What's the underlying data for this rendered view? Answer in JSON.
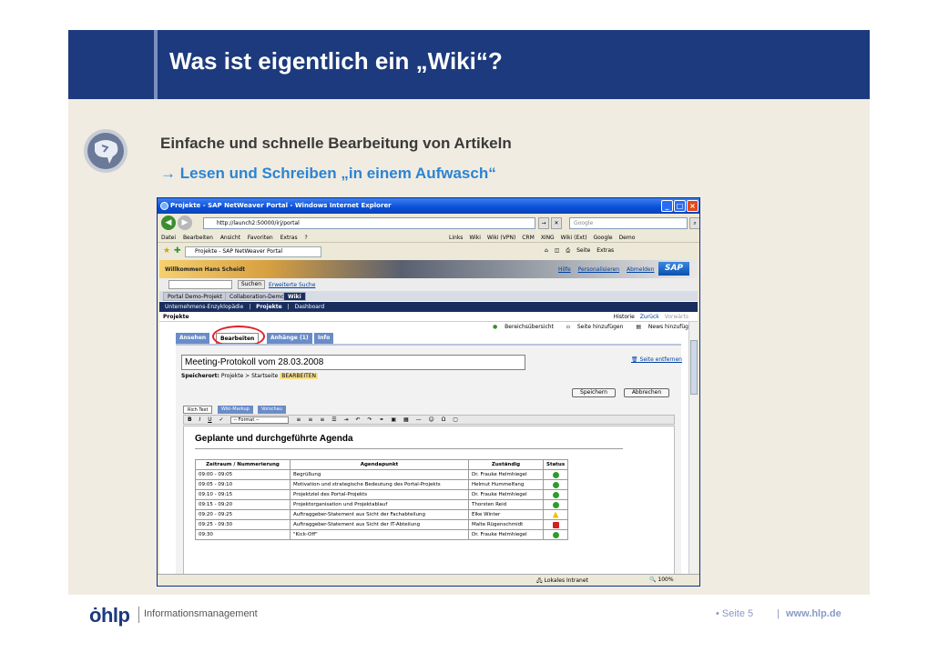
{
  "slide": {
    "title": "Was ist eigentlich ein „Wiki“?",
    "bullet1": "Einfache und schnelle Bearbeitung von Artikeln",
    "bullet2": "→ Lesen und Schreiben „in einem Aufwasch“"
  },
  "browser": {
    "window_title": "Projekte - SAP NetWeaver Portal - Windows Internet Explorer",
    "address": "http://launch2:50000/irj/portal",
    "search_placeholder": "Google",
    "menu": [
      "Datei",
      "Bearbeiten",
      "Ansicht",
      "Favoriten",
      "Extras",
      "?"
    ],
    "links_label": "Links",
    "links": [
      "Wiki",
      "Wiki (VPN)",
      "CRM",
      "XING",
      "Wiki (Ext)",
      "Google",
      "Demo"
    ],
    "tab_title": "Projekte - SAP NetWeaver Portal",
    "page_label": "Seite",
    "extras_label": "Extras",
    "status_zone": "Lokales Intranet",
    "zoom": "100%"
  },
  "portal": {
    "welcome": "Willkommen Hans Scheidt",
    "top_links": [
      "Hilfe",
      "Personalisieren",
      "Abmelden"
    ],
    "sap_logo": "SAP",
    "search_button": "Suchen",
    "search_link": "Erweiterte Suche",
    "nav": [
      "Portal Demo-Projekt",
      "Collaboration-Demo",
      "Wiki"
    ],
    "subnav": [
      "Unternehmens-Enzyklopädie",
      "|",
      "Projekte",
      "|",
      "Dashboard"
    ],
    "section": "Projekte",
    "history": [
      "Historie",
      "Zurück",
      "Vorwärts"
    ],
    "actions": [
      "Bereichsübersicht",
      "Seite hinzufügen",
      "News hinzufügen"
    ],
    "wiki_tabs": [
      "Ansehen",
      "Bearbeiten",
      "Anhänge (1)",
      "Info"
    ],
    "page_title_value": "Meeting-Protokoll vom 28.03.2008",
    "remove_page": "Seite entfernen",
    "save_label": "Speicherort:",
    "save_path": "Projekte > Startseite",
    "save_badge": "BEARBEITEN",
    "save_button": "Speichern",
    "cancel_button": "Abbrechen",
    "mode_tabs": [
      "Rich Text",
      "Wiki-Markup",
      "Vorschau"
    ],
    "format_select": "-- Format --"
  },
  "agenda": {
    "heading": "Geplante und durchgeführte Agenda",
    "headers": [
      "Zeitraum / Nummerierung",
      "Agendapunkt",
      "Zuständig",
      "Status"
    ],
    "rows": [
      [
        "09:00 - 09:05",
        "Begrüßung",
        "Dr. Frauke Helmhiegel",
        "ok"
      ],
      [
        "09:05 - 09:10",
        "Motivation und strategische Bedeutung des Portal-Projekts",
        "Helmut Hummelfang",
        "ok"
      ],
      [
        "09:10 - 09:15",
        "Projektziel des Portal-Projekts",
        "Dr. Frauke Helmhiegel",
        "ok"
      ],
      [
        "09:15 - 09:20",
        "Projektorganisation und Projektablauf",
        "Thorsten Reid",
        "ok"
      ],
      [
        "09:20 - 09:25",
        "Auftraggeber-Statement aus Sicht der Fachabteilung",
        "Elke Winter",
        "warn"
      ],
      [
        "09:25 - 09:30",
        "Auftraggeber-Statement aus Sicht der IT-Abteilung",
        "Malte Rügenschmidt",
        "err"
      ],
      [
        "09:30",
        "\"Kick-Off\"",
        "Dr. Frauke Helmhiegel",
        "ok"
      ]
    ]
  },
  "footer": {
    "logo": "hlp",
    "subtitle": "Informationsmanagement",
    "page": "• Seite 5",
    "separator": "|",
    "url": "www.hlp.de"
  }
}
